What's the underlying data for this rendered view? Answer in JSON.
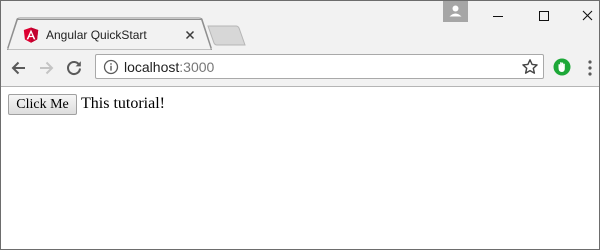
{
  "browser": {
    "tab": {
      "title": "Angular QuickStart",
      "icon": "angular-icon"
    },
    "address_bar": {
      "host": "localhost",
      "port": ":3000"
    },
    "colors": {
      "chrome_background": "#f2f2f2",
      "angular_red": "#dd0031",
      "extension_green": "#1da838"
    }
  },
  "page": {
    "button_label": "Click Me",
    "text": "This tutorial!"
  }
}
